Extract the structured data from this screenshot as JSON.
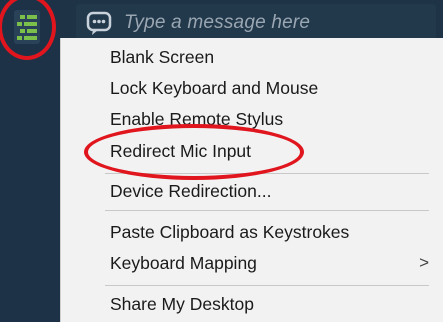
{
  "toolbar": {
    "app_icon": "app-menu-icon",
    "chat_icon": "chat-bubble-icon",
    "chat_placeholder": "Type a message here"
  },
  "menu": {
    "items": [
      {
        "label": "Blank Screen"
      },
      {
        "label": "Lock Keyboard and Mouse"
      },
      {
        "label": "Enable Remote Stylus"
      },
      {
        "label": "Redirect Mic Input"
      },
      {
        "label": "Device Redirection..."
      },
      {
        "label": "Paste Clipboard as Keystrokes"
      },
      {
        "label": "Keyboard Mapping",
        "submenu_arrow": ">"
      },
      {
        "label": "Share My Desktop"
      }
    ]
  },
  "colors": {
    "toolbar_bg": "#1e3446",
    "menu_bg": "#f2f2f2",
    "annotation": "#e0151d",
    "app_icon_green": "#7bc04a"
  }
}
